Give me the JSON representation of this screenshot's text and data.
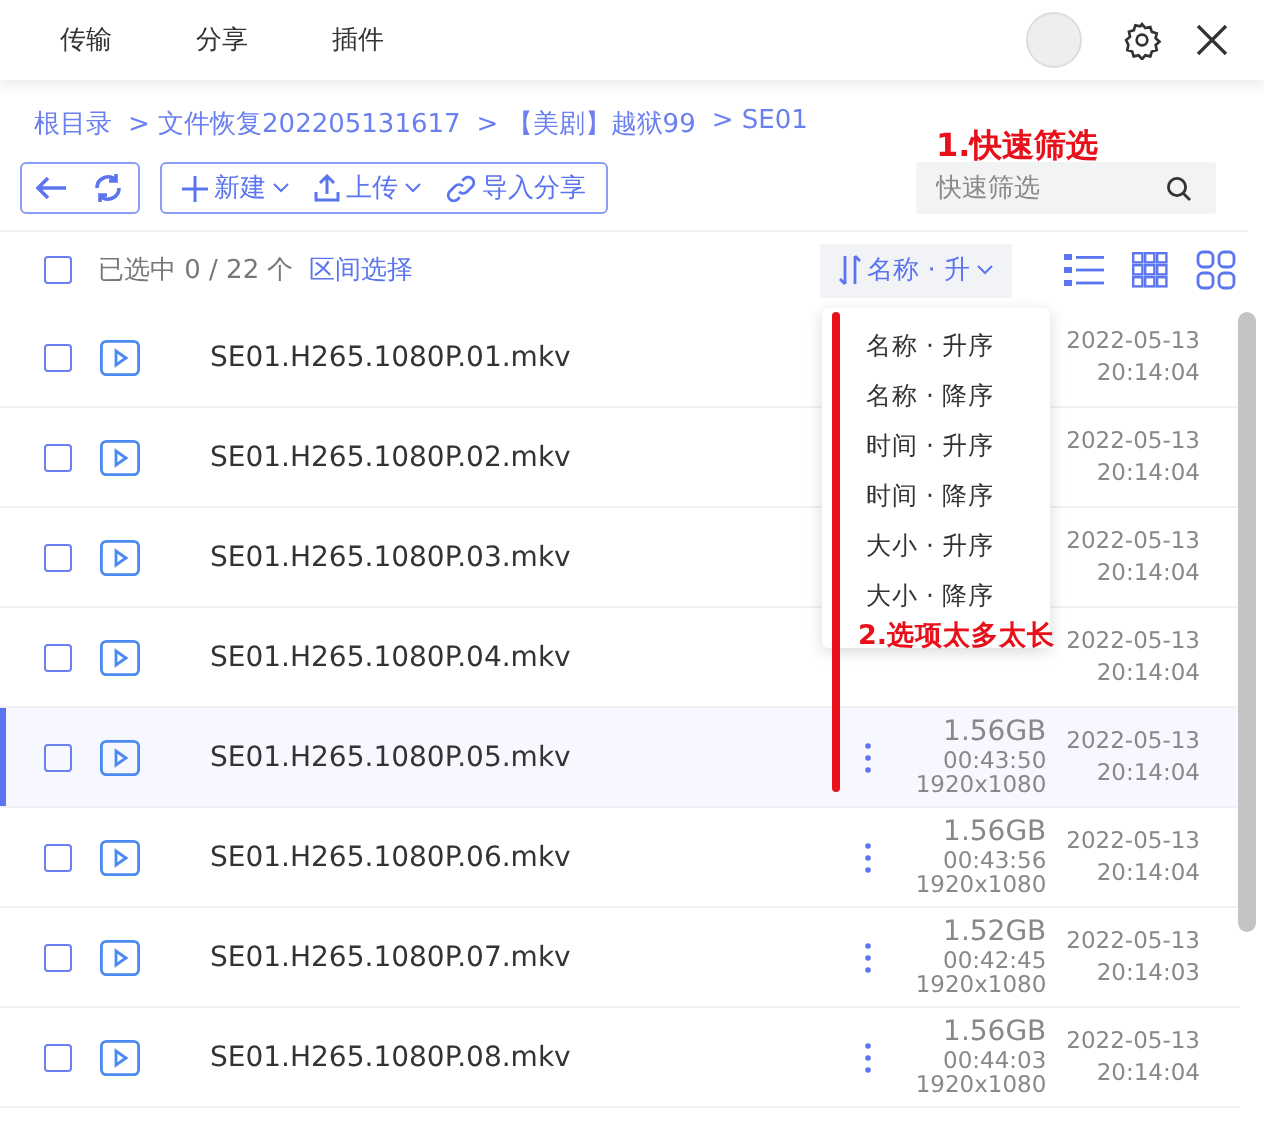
{
  "top_tabs": [
    {
      "label": "传输"
    },
    {
      "label": "分享"
    },
    {
      "label": "插件"
    }
  ],
  "breadcrumb": [
    {
      "label": "根目录"
    },
    {
      "label": "> 文件恢复202205131617"
    },
    {
      "label": "> 【美剧】越狱99"
    },
    {
      "label": "> SE01"
    }
  ],
  "toolbar": {
    "new": "新建",
    "upload": "上传",
    "import": "导入分享",
    "search_placeholder": "快速筛选"
  },
  "list_header": {
    "all_checked": false,
    "count": "已选中 0 / 22 个",
    "range_select": "区间选择",
    "sort": "名称 · 升"
  },
  "sort_menu": [
    "名称 · 升序",
    "名称 · 降序",
    "时间 · 升序",
    "时间 · 降序",
    "大小 · 升序",
    "大小 · 降序"
  ],
  "files": [
    {
      "name": "SE01.H265.1080P.01.mkv",
      "checked": false,
      "selected": false,
      "date": "2022-05-13",
      "time": "20:14:04"
    },
    {
      "name": "SE01.H265.1080P.02.mkv",
      "checked": false,
      "selected": false,
      "date": "2022-05-13",
      "time": "20:14:04"
    },
    {
      "name": "SE01.H265.1080P.03.mkv",
      "checked": false,
      "selected": false,
      "date": "2022-05-13",
      "time": "20:14:04"
    },
    {
      "name": "SE01.H265.1080P.04.mkv",
      "checked": false,
      "selected": false,
      "date": "2022-05-13",
      "time": "20:14:04"
    },
    {
      "name": "SE01.H265.1080P.05.mkv",
      "checked": false,
      "selected": true,
      "size": "1.56GB",
      "duration": "00:43:50",
      "resolution": "1920x1080",
      "date": "2022-05-13",
      "time": "20:14:04"
    },
    {
      "name": "SE01.H265.1080P.06.mkv",
      "checked": false,
      "selected": false,
      "size": "1.56GB",
      "duration": "00:43:56",
      "resolution": "1920x1080",
      "date": "2022-05-13",
      "time": "20:14:04"
    },
    {
      "name": "SE01.H265.1080P.07.mkv",
      "checked": false,
      "selected": false,
      "size": "1.52GB",
      "duration": "00:42:45",
      "resolution": "1920x1080",
      "date": "2022-05-13",
      "time": "20:14:03"
    },
    {
      "name": "SE01.H265.1080P.08.mkv",
      "checked": false,
      "selected": false,
      "size": "1.56GB",
      "duration": "00:44:03",
      "resolution": "1920x1080",
      "date": "2022-05-13",
      "time": "20:14:04"
    }
  ],
  "annotations": [
    "1.快速筛选",
    "2.选项太多太长"
  ]
}
